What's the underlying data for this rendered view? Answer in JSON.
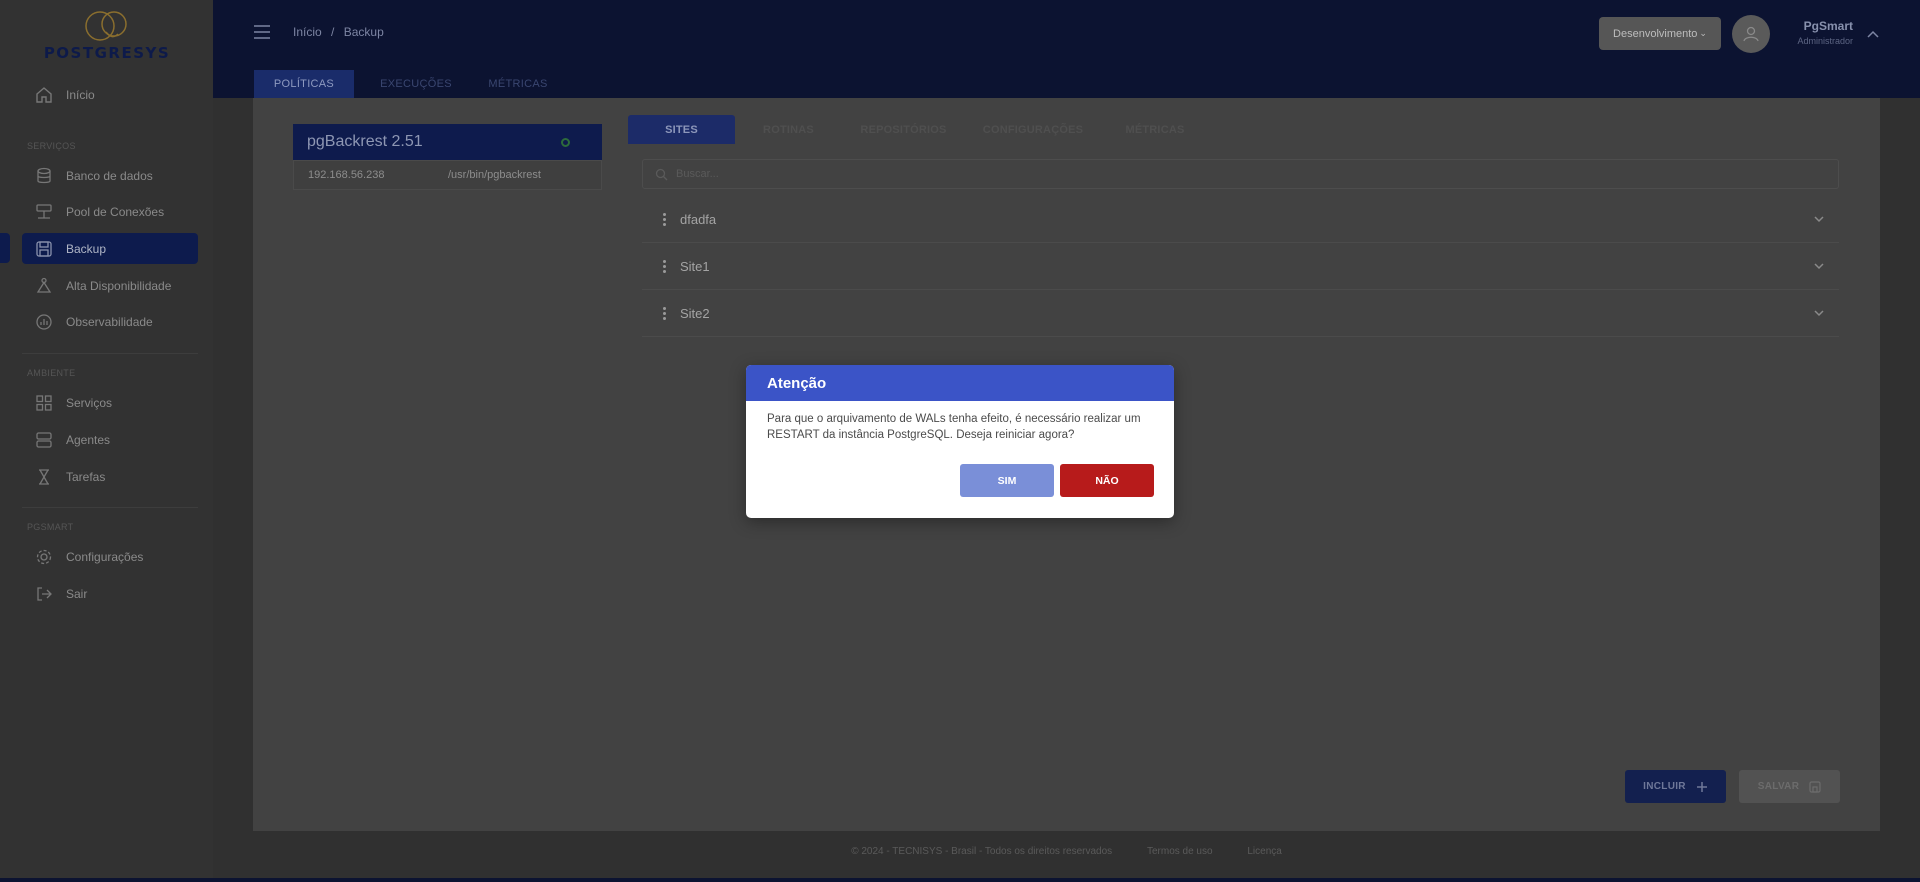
{
  "brand": {
    "name": "POSTGRESYS"
  },
  "sidebar": {
    "home": {
      "label": "Início",
      "icon": "home-icon"
    },
    "section_services": "SERVIÇOS",
    "services": [
      {
        "label": "Banco de dados",
        "icon": "database-icon"
      },
      {
        "label": "Pool de Conexões",
        "icon": "pool-icon"
      },
      {
        "label": "Backup",
        "icon": "backup-icon",
        "active": true
      },
      {
        "label": "Alta Disponibilidade",
        "icon": "high-availability-icon"
      },
      {
        "label": "Observabilidade",
        "icon": "chart-icon"
      }
    ],
    "section_environment": "AMBIENTE",
    "environment": [
      {
        "label": "Serviços",
        "icon": "grid-icon"
      },
      {
        "label": "Agentes",
        "icon": "server-icon"
      },
      {
        "label": "Tarefas",
        "icon": "hourglass-icon"
      }
    ],
    "section_pgsmart": "PGSMART",
    "pgsmart": [
      {
        "label": "Configurações",
        "icon": "gear-icon"
      },
      {
        "label": "Sair",
        "icon": "logout-icon"
      }
    ]
  },
  "header": {
    "breadcrumb_home": "Início",
    "breadcrumb_sep": "/",
    "breadcrumb_current": "Backup",
    "environment": "Desenvolvimento",
    "user_name": "PgSmart",
    "user_role": "Administrador"
  },
  "main_tabs": [
    "POLÍTICAS",
    "EXECUÇÕES",
    "MÉTRICAS"
  ],
  "server": {
    "title": "pgBackrest 2.51",
    "ip": "192.168.56.238",
    "path": "/usr/bin/pgbackrest"
  },
  "sub_tabs": [
    "SITES",
    "ROTINAS",
    "REPOSITÓRIOS",
    "CONFIGURAÇÕES",
    "MÉTRICAS"
  ],
  "search": {
    "placeholder": "Buscar..."
  },
  "sites": [
    "dfadfa",
    "Site1",
    "Site2"
  ],
  "actions": {
    "incluir": "INCLUIR",
    "salvar": "SALVAR"
  },
  "modal": {
    "title": "Atenção",
    "message": "Para que o arquivamento de WALs tenha efeito, é necessário realizar um RESTART da instância PostgreSQL. Deseja reiniciar agora?",
    "yes": "SIM",
    "no": "NÃO"
  },
  "footer": {
    "copyright": "© 2024 - TECNISYS - Brasil - Todos os direitos reservados",
    "terms": "Termos de uso",
    "license": "Licença"
  },
  "colors": {
    "accent": "#3b54c7",
    "danger": "#b71b1b",
    "nav_active": "#0d1b4d"
  }
}
